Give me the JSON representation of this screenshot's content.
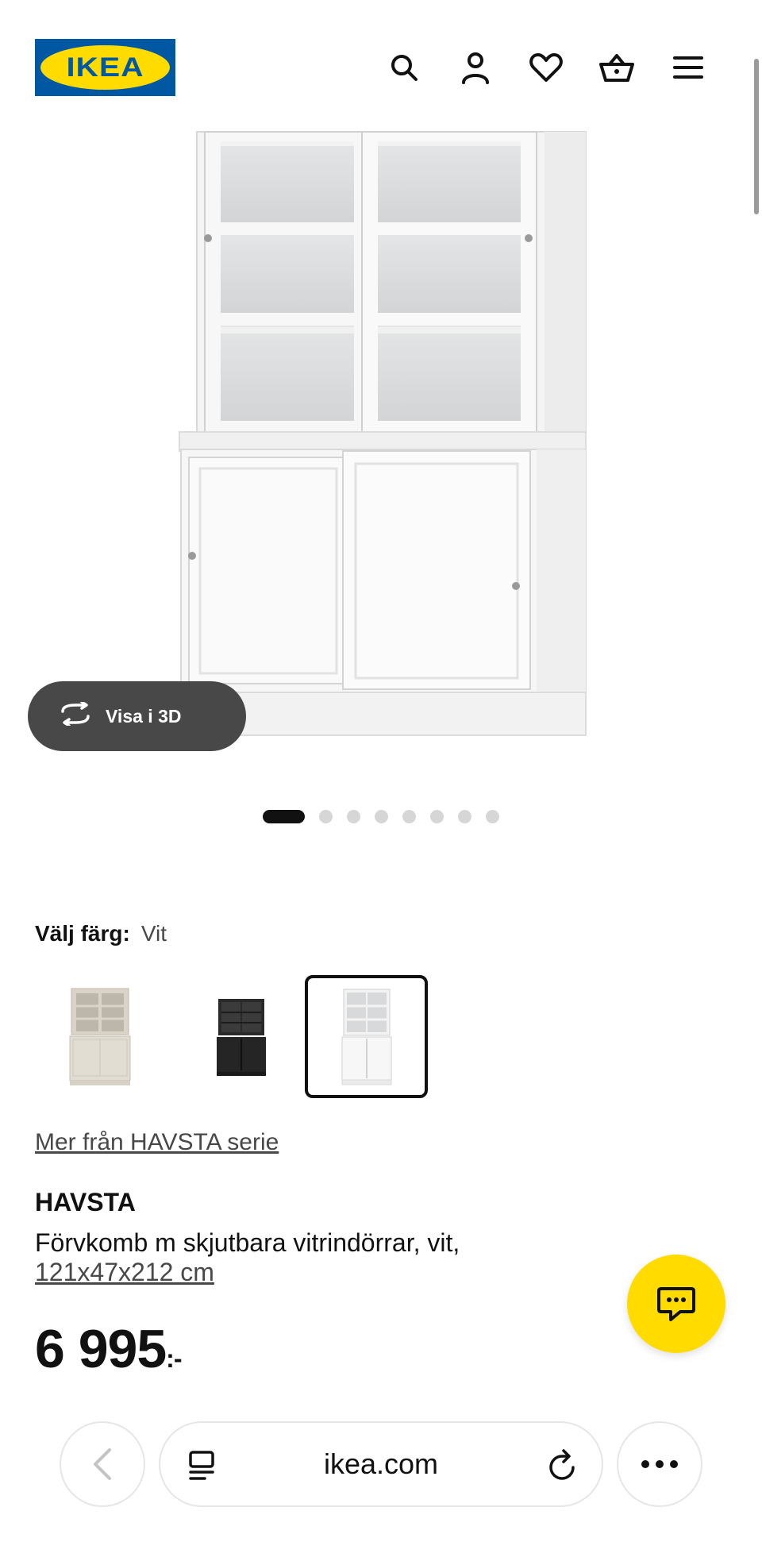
{
  "header": {
    "logo_text": "IKEA",
    "icons": [
      "search-icon",
      "account-icon",
      "heart-icon",
      "basket-icon",
      "menu-icon"
    ]
  },
  "gallery": {
    "view3d_label": "Visa i 3D",
    "image_count": 8,
    "active_index": 0
  },
  "color": {
    "label": "Välj färg:",
    "value": "Vit",
    "options": [
      "beige",
      "black",
      "white"
    ],
    "selected_index": 2
  },
  "series_link": "Mer från HAVSTA serie",
  "product": {
    "name": "HAVSTA",
    "description": "Förvkomb m skjutbara vitrindörrar, vit,",
    "size": "121x47x212 cm",
    "price": "6 995",
    "price_suffix": ":-"
  },
  "browser": {
    "url": "ikea.com"
  },
  "colors": {
    "ikea_blue": "#0058a3",
    "ikea_yellow": "#ffdb00",
    "dark_button": "#484848"
  }
}
